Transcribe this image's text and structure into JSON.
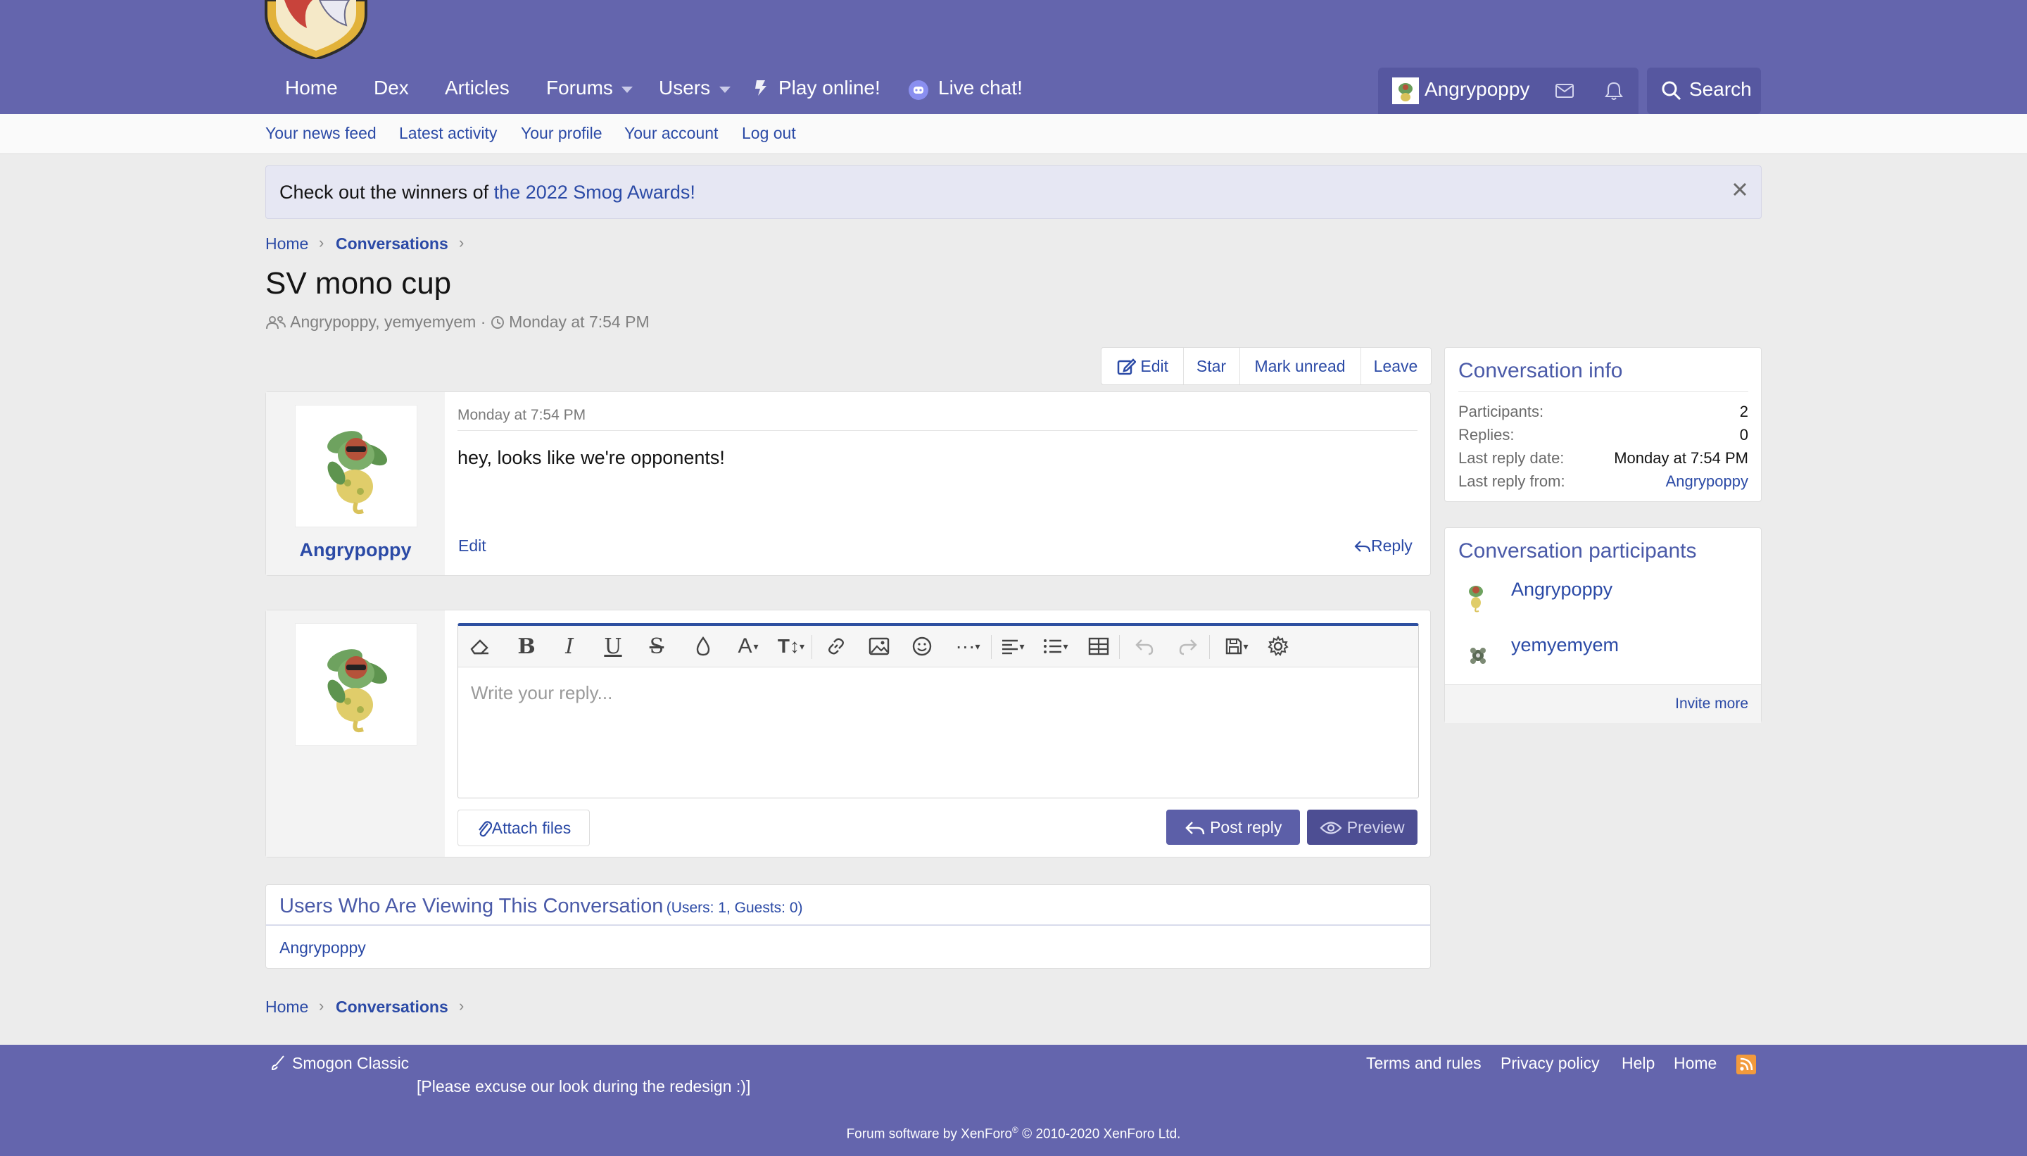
{
  "nav": {
    "items": [
      "Home",
      "Dex",
      "Articles",
      "Forums",
      "Users",
      "Play online!",
      "Live chat!"
    ],
    "username": "Angrypoppy",
    "search_label": "Search"
  },
  "subnav": [
    "Your news feed",
    "Latest activity",
    "Your profile",
    "Your account",
    "Log out"
  ],
  "notice": {
    "text": "Check out the winners of ",
    "link": "the 2022 Smog Awards!"
  },
  "breadcrumb": {
    "home": "Home",
    "current": "Conversations"
  },
  "conversation": {
    "title": "SV mono cup",
    "participants_line": "Angrypoppy, yemyemyem",
    "sep": "·",
    "date": "Monday at 7:54 PM"
  },
  "actions": {
    "edit": "Edit",
    "star": "Star",
    "mark_unread": "Mark unread",
    "leave": "Leave"
  },
  "message": {
    "author": "Angrypoppy",
    "timestamp": "Monday at 7:54 PM",
    "body": "hey, looks like we're opponents!",
    "edit_label": "Edit",
    "reply_label": "Reply"
  },
  "editor": {
    "placeholder": "Write your reply...",
    "attach_label": "Attach files",
    "post_label": "Post reply",
    "preview_label": "Preview",
    "toolbar": [
      "eraser-icon",
      "bold-icon",
      "italic-icon",
      "underline-icon",
      "strikethrough-icon",
      "text-color-icon",
      "font-family-icon",
      "font-size-icon",
      "link-icon",
      "image-icon",
      "smilie-icon",
      "more-icon",
      "align-icon",
      "list-icon",
      "table-icon",
      "undo-icon",
      "redo-icon",
      "drafts-icon",
      "settings-icon"
    ]
  },
  "viewers": {
    "title": "Users Who Are Viewing This Conversation",
    "counts": "(Users: 1, Guests: 0)",
    "user": "Angrypoppy"
  },
  "info": {
    "title": "Conversation info",
    "rows": [
      {
        "label": "Participants:",
        "value": "2"
      },
      {
        "label": "Replies:",
        "value": "0"
      },
      {
        "label": "Last reply date:",
        "value": "Monday at 7:54 PM"
      },
      {
        "label": "Last reply from:",
        "value": "Angrypoppy"
      }
    ]
  },
  "participants": {
    "title": "Conversation participants",
    "list": [
      "Angrypoppy",
      "yemyemyem"
    ],
    "invite": "Invite more"
  },
  "footer": {
    "style": "Smogon Classic",
    "note": "[Please excuse our look during the redesign :)]",
    "links": [
      "Terms and rules",
      "Privacy policy",
      "Help",
      "Home"
    ],
    "copyright_a": "Forum software by XenForo",
    "copyright_b": " © 2010-2020 XenForo Ltd."
  },
  "colors": {
    "header": "#6465ad",
    "accent": "#2b4aa6",
    "button": "#5c5fa8",
    "rss": "#f29a3c"
  }
}
